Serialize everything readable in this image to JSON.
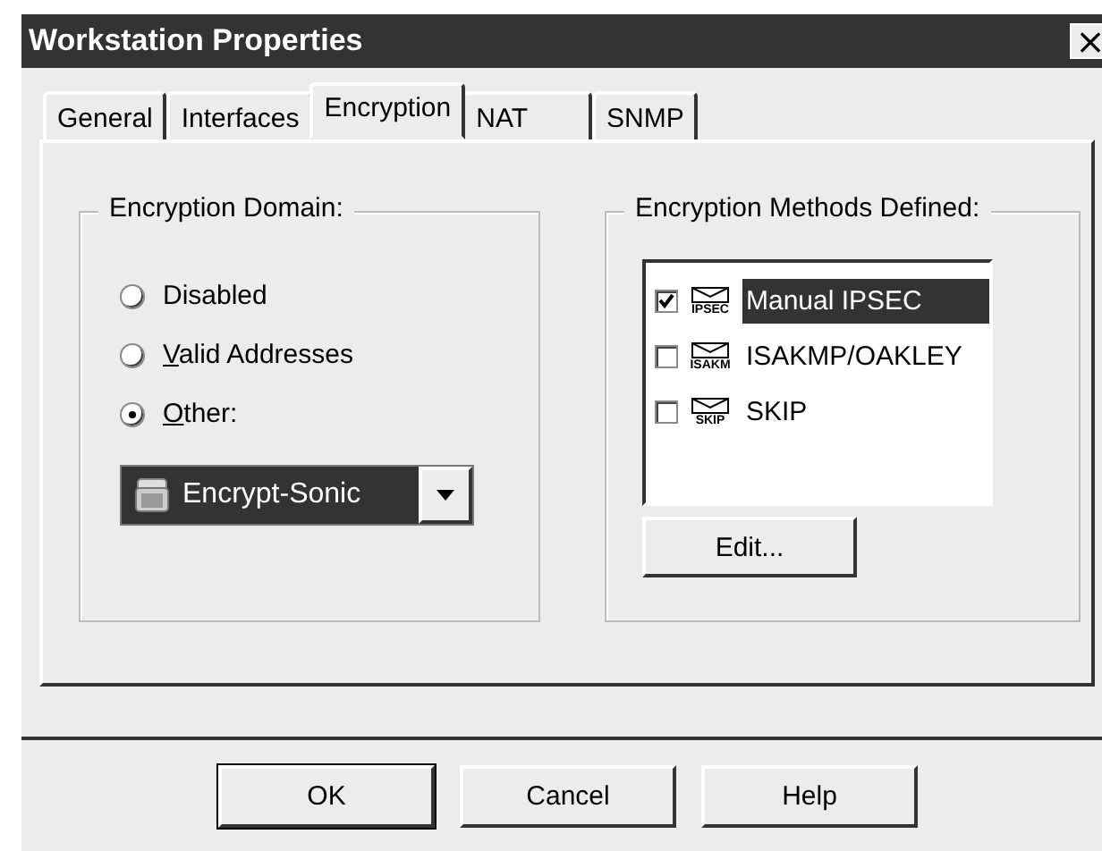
{
  "window": {
    "title": "Workstation Properties",
    "close": "×"
  },
  "tabs": [
    {
      "label": "General",
      "selected": false
    },
    {
      "label": "Interfaces",
      "selected": false
    },
    {
      "label": "Encryption",
      "selected": true
    },
    {
      "label": "NAT",
      "selected": false
    },
    {
      "label": "SNMP",
      "selected": false
    }
  ],
  "domain": {
    "title": "Encryption Domain:",
    "options": [
      {
        "label": "Disabled",
        "selected": false,
        "underline_first": false
      },
      {
        "label": "Valid Addresses",
        "selected": false,
        "underline_first": true
      },
      {
        "label": "Other:",
        "selected": true,
        "underline_first": true
      }
    ],
    "dropdown": {
      "value": "Encrypt-Sonic",
      "focused": true
    }
  },
  "methods": {
    "title": "Encryption Methods Defined:",
    "items": [
      {
        "label": "Manual IPSEC",
        "icon_text": "IPSEC",
        "checked": true,
        "selected": true
      },
      {
        "label": "ISAKMP/OAKLEY",
        "icon_text": "ISAKM",
        "checked": false,
        "selected": false
      },
      {
        "label": "SKIP",
        "icon_text": "SKIP",
        "checked": false,
        "selected": false
      }
    ],
    "edit_button": "Edit..."
  },
  "buttons": [
    {
      "label": "OK",
      "default": true
    },
    {
      "label": "Cancel",
      "default": false
    },
    {
      "label": "Help",
      "default": false
    }
  ]
}
